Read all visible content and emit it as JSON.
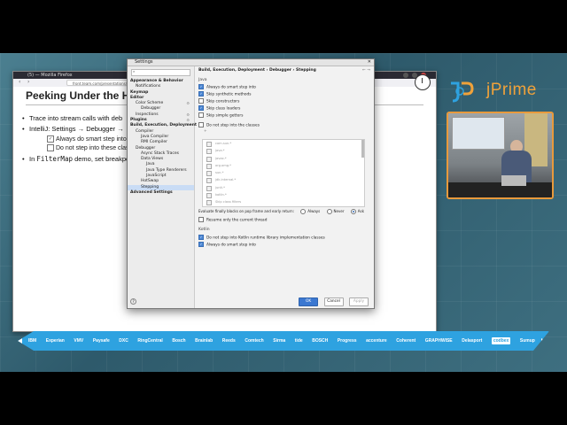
{
  "firefox": {
    "window_title": "(5) — Mozilla Firefox",
    "url": "front.team.com/presentations/2024/jprime-streams/#/2"
  },
  "slide": {
    "title": "Peeking Under the Hood",
    "bullets": [
      {
        "text": "Trace into stream calls with deb"
      },
      {
        "text": "IntelliJ: Settings → Debugger →"
      },
      {
        "text": "In ",
        "code": "FilterMap",
        "rest": " demo, set breakpo"
      }
    ],
    "subitems": [
      {
        "label": "Always do smart step into",
        "checked": true
      },
      {
        "label": "Do not step into these classe",
        "checked": false
      }
    ]
  },
  "settings": {
    "title": "Settings",
    "search_placeholder": "",
    "breadcrumb": "Build, Execution, Deployment  ›  Debugger  ›  Stepping",
    "tree": [
      {
        "label": "Appearance & Behavior",
        "bold": true,
        "indent": 1
      },
      {
        "label": "Notifications",
        "bold": false,
        "indent": 2
      },
      {
        "label": "Keymap",
        "bold": true,
        "indent": 1
      },
      {
        "label": "Editor",
        "bold": true,
        "indent": 1
      },
      {
        "label": "Color Scheme",
        "bold": false,
        "indent": 2
      },
      {
        "label": "Debugger",
        "bold": false,
        "indent": 3
      },
      {
        "label": "Inspections",
        "bold": false,
        "indent": 2
      },
      {
        "label": "Plugins",
        "bold": true,
        "indent": 1
      },
      {
        "label": "Build, Execution, Deployment",
        "bold": true,
        "indent": 1
      },
      {
        "label": "Compiler",
        "bold": false,
        "indent": 2
      },
      {
        "label": "Java Compiler",
        "bold": false,
        "indent": 3
      },
      {
        "label": "RMI Compiler",
        "bold": false,
        "indent": 3
      },
      {
        "label": "Debugger",
        "bold": false,
        "indent": 2
      },
      {
        "label": "Async Stack Traces",
        "bold": false,
        "indent": 3
      },
      {
        "label": "Data Views",
        "bold": false,
        "indent": 3
      },
      {
        "label": "Java",
        "bold": false,
        "indent": 4
      },
      {
        "label": "Java Type Renderers",
        "bold": false,
        "indent": 4
      },
      {
        "label": "JavaScript",
        "bold": false,
        "indent": 4
      },
      {
        "label": "HotSwap",
        "bold": false,
        "indent": 3
      },
      {
        "label": "Stepping",
        "bold": false,
        "indent": 3,
        "selected": true
      },
      {
        "label": "Advanced Settings",
        "bold": true,
        "indent": 1
      }
    ],
    "java_section": "Java",
    "java_options": [
      {
        "label": "Always do smart step into",
        "checked": true
      },
      {
        "label": "Skip synthetic methods",
        "checked": true
      },
      {
        "label": "Skip constructors",
        "checked": false
      },
      {
        "label": "Skip class loaders",
        "checked": true
      },
      {
        "label": "Skip simple getters",
        "checked": false
      },
      {
        "label": "Do not step into the classes",
        "checked": false
      }
    ],
    "class_filters": [
      "com.sun.*",
      "java.*",
      "javax.*",
      "org.omg.*",
      "sun.*",
      "jdk.internal.*",
      "junit.*",
      "kotlin.*",
      "Skip class filters"
    ],
    "finally_label": "Evaluate finally blocks on pop frame and early return:",
    "finally_choices": [
      "Always",
      "Never",
      "Ask"
    ],
    "finally_selected": "Ask",
    "resume_label": "Resume only the current thread",
    "resume_checked": false,
    "kotlin_section": "Kotlin",
    "kotlin_options": [
      {
        "label": "Do not step into Kotlin runtime library implementation classes",
        "checked": true
      },
      {
        "label": "Always do smart step into",
        "checked": true
      }
    ],
    "buttons": {
      "ok": "OK",
      "cancel": "Cancel",
      "apply": "Apply"
    }
  },
  "branding": {
    "name": "jPrime",
    "accent": "#f0a23a",
    "mark_color": "#2ea2e0"
  },
  "sponsors": [
    "IBM",
    "Experian",
    "VMV",
    "Paysafe",
    "DXC",
    "RingCentral",
    "Bosch",
    "Brainlab",
    "Reeds",
    "Comtech",
    "Sirma",
    "tide",
    "BOSCH",
    "Progress",
    "accenture",
    "Coherent",
    "GRAPHWISE",
    "Delasport",
    "codbex",
    "Sumup"
  ],
  "sponsor_bar_color": "#2ea2e0"
}
